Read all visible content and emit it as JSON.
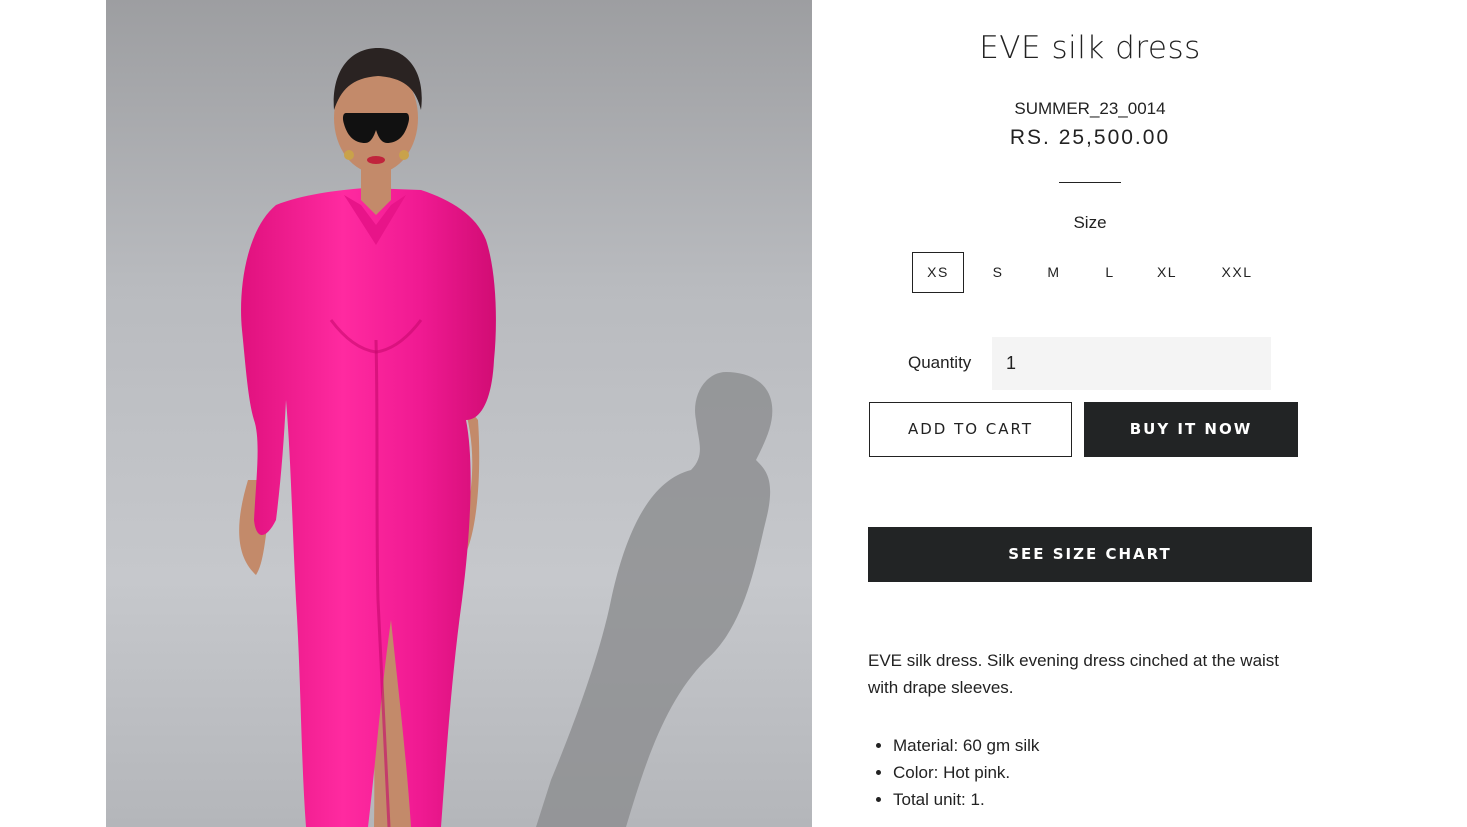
{
  "product": {
    "title": "EVE silk dress",
    "sku": "SUMMER_23_0014",
    "price": "RS. 25,500.00",
    "image_alt": "Model wearing hot pink silk shirt dress"
  },
  "size": {
    "label": "Size",
    "options": [
      "XS",
      "S",
      "M",
      "L",
      "XL",
      "XXL"
    ],
    "selected": "XS"
  },
  "quantity": {
    "label": "Quantity",
    "value": "1"
  },
  "buttons": {
    "add_to_cart": "ADD TO CART",
    "buy_now": "BUY IT NOW",
    "size_chart": "SEE SIZE CHART"
  },
  "description": {
    "text": "EVE silk dress. Silk evening dress cinched at the waist with drape sleeves.",
    "features": [
      "Material: 60 gm silk",
      "Color: Hot pink.",
      "Total unit: 1."
    ]
  },
  "colors": {
    "dress": "#ff1e9a",
    "button_dark": "#222425",
    "input_bg": "#f4f4f4"
  }
}
